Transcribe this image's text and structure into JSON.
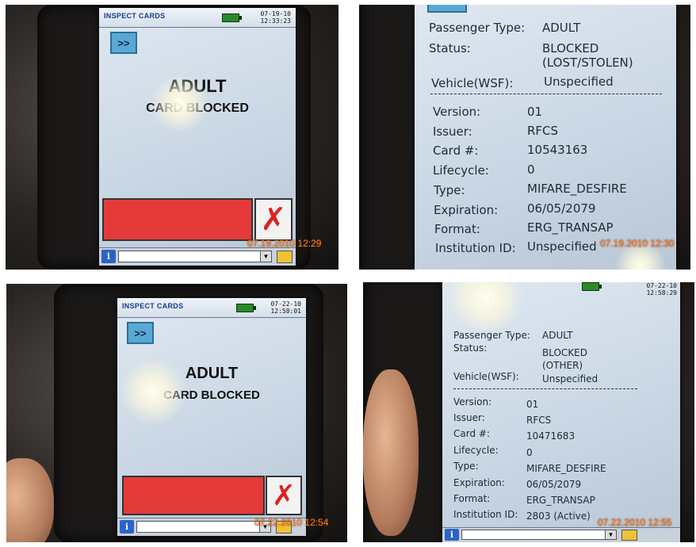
{
  "panels": [
    {
      "app_title": "INSPECT CARDS",
      "date": "07-19-10",
      "time": "12:33:23",
      "next_label": ">>",
      "card_type": "ADULT",
      "card_status": "CARD BLOCKED",
      "close_symbol": "✗",
      "info_symbol": "i",
      "photo_stamp": "07.19.2010  12:29"
    },
    {
      "fields": [
        {
          "label": "Passenger Type:",
          "value": "ADULT"
        },
        {
          "label": "Status:",
          "value": "BLOCKED",
          "value2": "(LOST/STOLEN)"
        },
        {
          "label": "Vehicle(WSF):",
          "value": "Unspecified"
        },
        {
          "label": "Version:",
          "value": "01"
        },
        {
          "label": "Issuer:",
          "value": "RFCS"
        },
        {
          "label": "Card #:",
          "value": "10543163"
        },
        {
          "label": "Lifecycle:",
          "value": "0"
        },
        {
          "label": "Type:",
          "value": "MIFARE_DESFIRE"
        },
        {
          "label": "Expiration:",
          "value": "06/05/2079"
        },
        {
          "label": "Format:",
          "value": "ERG_TRANSAP"
        },
        {
          "label": "Institution ID:",
          "value": "Unspecified"
        }
      ],
      "photo_stamp": "07.19.2010  12:30"
    },
    {
      "app_title": "INSPECT CARDS",
      "date": "07-22-10",
      "time": "12:58:01",
      "next_label": ">>",
      "card_type": "ADULT",
      "card_status": "CARD BLOCKED",
      "close_symbol": "✗",
      "info_symbol": "i",
      "photo_stamp": "07.22.2010  12:54"
    },
    {
      "date": "07-22-10",
      "time": "12:58:29",
      "fields": [
        {
          "label": "Passenger Type:",
          "value": "ADULT"
        },
        {
          "label": "Status:",
          "value": "BLOCKED",
          "value2": "(OTHER)"
        },
        {
          "label": "Vehicle(WSF):",
          "value": "Unspecified"
        },
        {
          "label": "Version:",
          "value": "01"
        },
        {
          "label": "Issuer:",
          "value": "RFCS"
        },
        {
          "label": "Card #:",
          "value": "10471683"
        },
        {
          "label": "Lifecycle:",
          "value": "0"
        },
        {
          "label": "Type:",
          "value": "MIFARE_DESFIRE"
        },
        {
          "label": "Expiration:",
          "value": "06/05/2079"
        },
        {
          "label": "Format:",
          "value": "ERG_TRANSAP"
        },
        {
          "label": "Institution ID:",
          "value": "2803 (Active)"
        }
      ],
      "info_symbol": "i",
      "photo_stamp": "07.22.2010  12:55"
    }
  ],
  "colors": {
    "blocked_bar": "#e53a3a",
    "close_x": "#dd2222",
    "arrow_button": "#5aa9d4",
    "battery": "#2a8a2a",
    "timestamp": "#ff7a1a"
  }
}
